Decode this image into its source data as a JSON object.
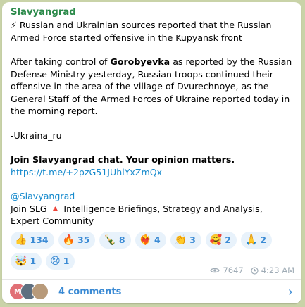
{
  "channel": {
    "name": "Slavyangrad"
  },
  "post": {
    "headline_icon": "⚡",
    "headline": "Russian and Ukrainian sources reported that the Russian Armed Force started offensive in the Kupyansk front",
    "para_prefix": "After taking control of ",
    "para_bold": "Gorobyevka",
    "para_suffix": " as reported by the Russian Defense Ministry yesterday, Russian troops continued their offensive in the area of  the village of Dvurechnoye, as the General Staff of the Armed Forces of Ukraine reported today in the morning report.",
    "source": "-Ukraina_ru",
    "join_chat": "Join Slavyangrad chat. Your opinion matters.",
    "chat_link": "https://t.me/+2pzG51JUhlYxZmQx",
    "handle": "@Slavyangrad",
    "slg_prefix": "Join SLG ",
    "slg_icon": "🔺",
    "slg_suffix": " Intelligence Briefings, Strategy and Analysis, Expert Community"
  },
  "reactions": [
    {
      "emoji": "👍",
      "count": "134"
    },
    {
      "emoji": "🔥",
      "count": "35"
    },
    {
      "emoji": "🍾",
      "count": "8"
    },
    {
      "emoji": "❤️‍🔥",
      "count": "4"
    },
    {
      "emoji": "👏",
      "count": "3"
    },
    {
      "emoji": "🥰",
      "count": "2"
    },
    {
      "emoji": "🙏",
      "count": "2"
    },
    {
      "emoji": "🤯",
      "count": "1"
    },
    {
      "emoji": "😢",
      "count": "1"
    }
  ],
  "meta": {
    "views": "7647",
    "time": "4:23 AM"
  },
  "footer": {
    "comments_label": "4 comments",
    "avatar_1_letter": "M"
  },
  "colors": {
    "background": "#c9d3a8",
    "channel_name": "#2b8a4a",
    "link": "#168acd",
    "reaction_bg": "#e8f2fb"
  }
}
